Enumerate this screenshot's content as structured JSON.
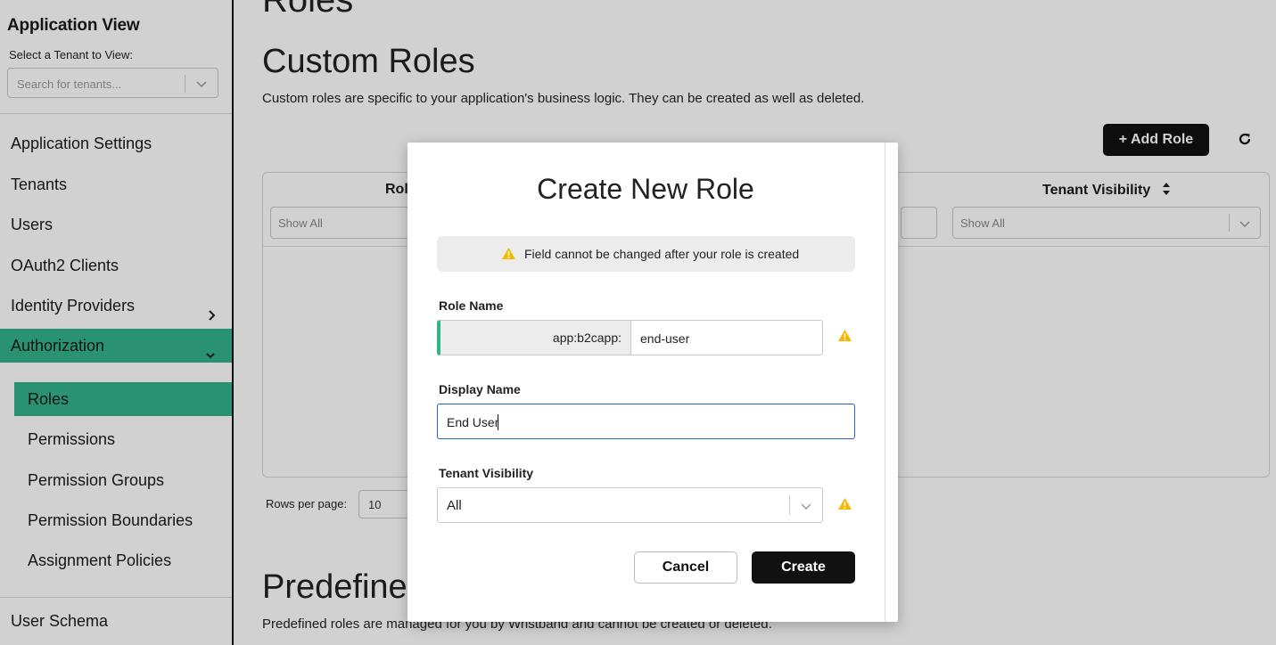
{
  "sidebar": {
    "title": "Application View",
    "tenant_label": "Select a Tenant to View:",
    "tenant_placeholder": "Search for tenants...",
    "nav": {
      "app_settings": "Application Settings",
      "tenants": "Tenants",
      "users": "Users",
      "oauth2": "OAuth2 Clients",
      "idp": "Identity Providers",
      "authorization": "Authorization",
      "user_schema": "User Schema"
    },
    "auth_items": {
      "roles": "Roles",
      "permissions": "Permissions",
      "permission_groups": "Permission Groups",
      "permission_boundaries": "Permission Boundaries",
      "assignment_policies": "Assignment Policies"
    }
  },
  "main": {
    "page_title": "Roles",
    "custom_title": "Custom Roles",
    "custom_desc": "Custom roles are specific to your application's business logic. They can be created as well as deleted.",
    "add_role": "+ Add Role",
    "table": {
      "col_role": "Rol",
      "col_tenant_visibility": "Tenant Visibility",
      "filter_placeholder": "Show All"
    },
    "rows_per_page_label": "Rows per page:",
    "rows_per_page_value": "10",
    "predefined_title": "Predefined",
    "predefined_desc": "Predefined roles are managed for you by Wristband and cannot be created or deleted."
  },
  "modal": {
    "title": "Create New Role",
    "notice": "Field cannot be changed after your role is created",
    "role_name_label": "Role Name",
    "role_name_prefix": "app:b2capp:",
    "role_name_value": "end-user",
    "display_name_label": "Display Name",
    "display_name_value": "End User",
    "tenant_visibility_label": "Tenant Visibility",
    "tenant_visibility_value": "All",
    "cancel": "Cancel",
    "create": "Create"
  },
  "colors": {
    "accent": "#33b38b",
    "primary_button": "#111111",
    "warning": "#f5b800",
    "focus": "#2563c7"
  }
}
